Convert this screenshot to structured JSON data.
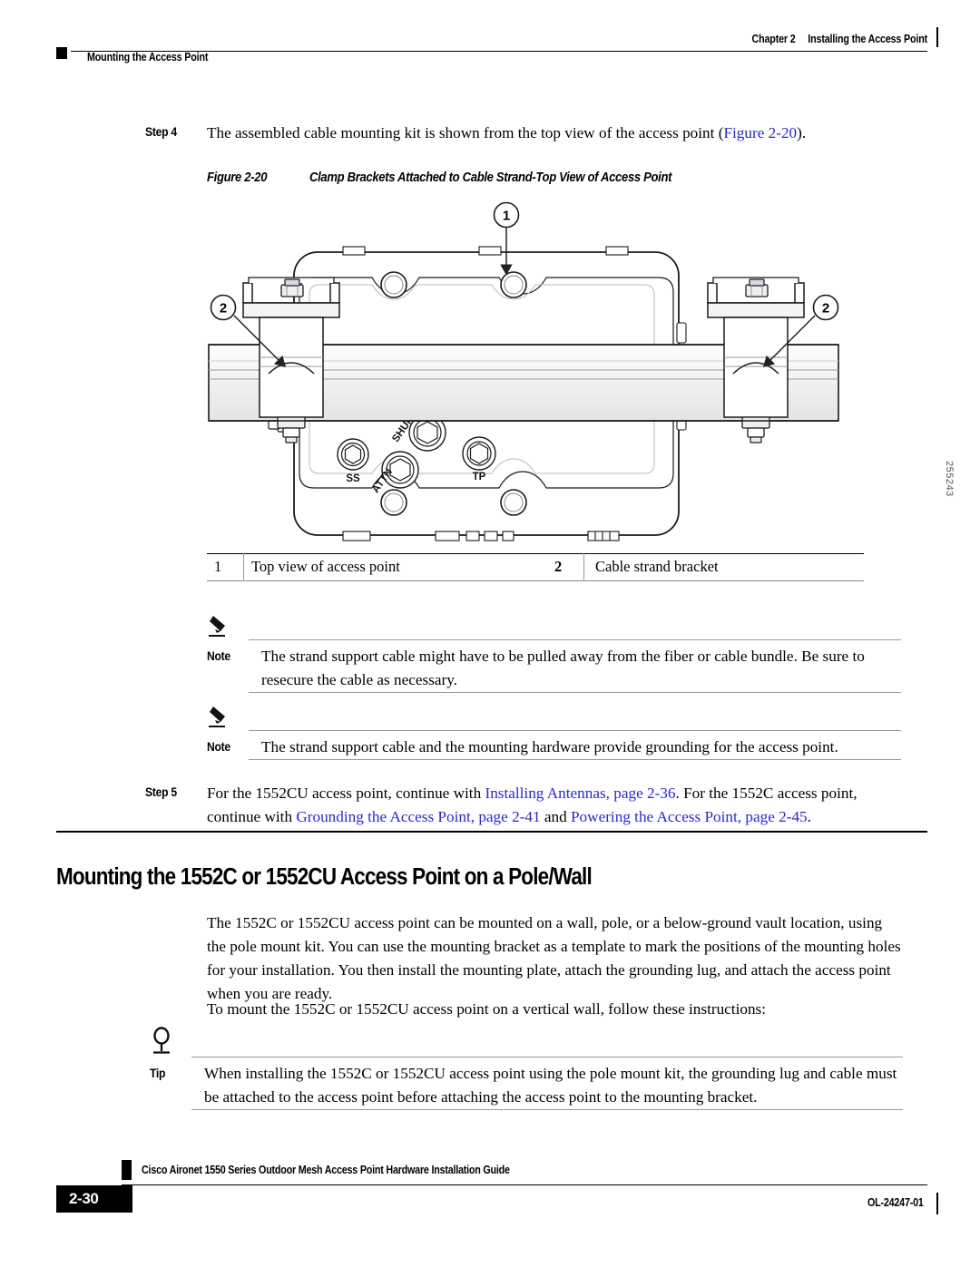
{
  "header": {
    "chapter": "Chapter 2",
    "chapter_title": "Installing the Access Point",
    "section": "Mounting the Access Point"
  },
  "step4": {
    "label": "Step 4",
    "text_before": "The assembled cable mounting kit is shown from the top view of the access point (",
    "link": "Figure 2-20",
    "text_after": ")."
  },
  "figure": {
    "number": "Figure 2-20",
    "title": "Clamp Brackets Attached to Cable Strand-Top View of Access Point",
    "drawing_id": "255243",
    "callouts": [
      {
        "id": "1",
        "label": "Top view of access point"
      },
      {
        "id": "2",
        "label": "Cable strand bracket"
      }
    ],
    "port_labels": {
      "ss": "SS",
      "attn": "ATTN",
      "shunt": "SHUNT",
      "tp": "TP"
    }
  },
  "legend": {
    "rows": [
      {
        "num": "1",
        "desc": "Top view of access point",
        "num2": "2",
        "desc2": "Cable strand bracket"
      }
    ]
  },
  "note1": {
    "keyword": "Note",
    "text": "The strand support cable might have to be pulled away from the fiber or cable bundle. Be sure to resecure the cable as necessary."
  },
  "note2": {
    "keyword": "Note",
    "text": "The strand support cable and the mounting hardware provide grounding for the access point."
  },
  "step5": {
    "label": "Step 5",
    "seg1": "For the 1552CU access point, continue with ",
    "link1": "Installing Antennas, page 2-36",
    "seg2": ". For the 1552C access point, continue with ",
    "link2": "Grounding the Access Point, page 2-41",
    "seg3": " and ",
    "link3": "Powering the Access Point, page 2-45",
    "seg4": "."
  },
  "section": {
    "heading": "Mounting the 1552C or 1552CU Access Point on a Pole/Wall",
    "paragraph1": "The 1552C or 1552CU access point can be mounted on a wall, pole, or a below-ground vault location, using the pole mount kit. You can use the mounting bracket as a template to mark the positions of the mounting holes for your installation. You then install the mounting plate, attach the grounding lug, and attach the access point when you are ready.",
    "paragraph2": "To mount the 1552C or 1552CU access point on a vertical wall, follow these instructions:"
  },
  "tip": {
    "keyword": "Tip",
    "text": "When installing the 1552C or 1552CU access point using the pole mount kit, the grounding lug and cable must be attached to the access point before attaching the access point to the mounting bracket."
  },
  "footer": {
    "page": "2-30",
    "title": "Cisco Aironet 1550 Series Outdoor Mesh Access Point Hardware Installation Guide",
    "doc_id": "OL-24247-01"
  },
  "colors": {
    "link": "#2A2AC8",
    "rule": "#9a9a9a",
    "text": "#000000"
  }
}
